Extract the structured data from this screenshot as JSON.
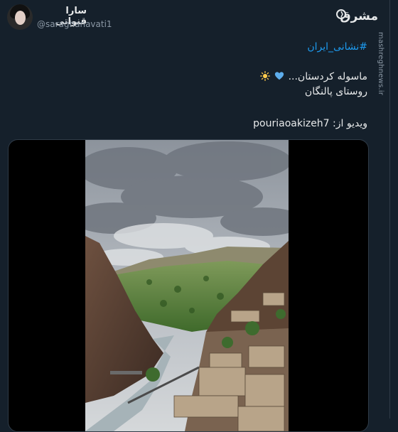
{
  "author": {
    "display_name": "سارا قنواتی",
    "handle": "@saraghanavati1"
  },
  "brand": {
    "logo_text": "مشرق",
    "site_url": "mashreghnews.ir"
  },
  "tweet": {
    "hashtag": "#نشانی_ایران",
    "line1": "ماسوله کردستان...",
    "line2": "روستای پالنگان",
    "credit_prefix": "ویدیو از:",
    "credit_user": "pouriaoakizeh7",
    "emojis": [
      "blue-heart",
      "sun"
    ]
  },
  "colors": {
    "background": "#15202b",
    "link": "#1d9bf0",
    "muted": "#8b98a5"
  }
}
